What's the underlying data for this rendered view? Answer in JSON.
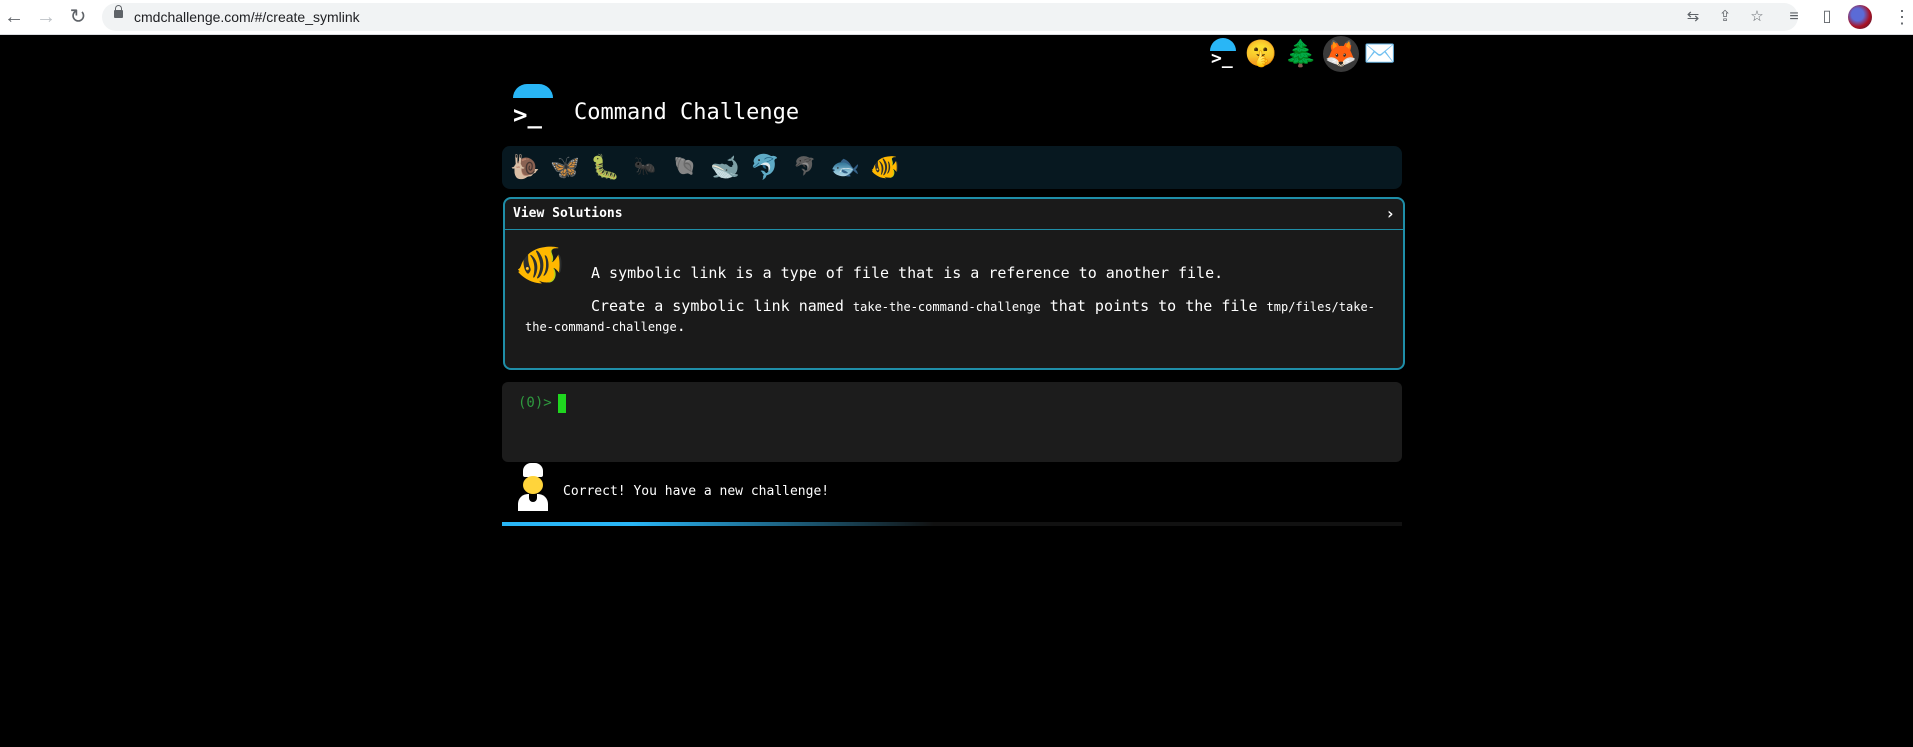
{
  "browser": {
    "url": "cmdchallenge.com/#/create_symlink",
    "back_icon": "arrow-left-icon",
    "forward_icon": "arrow-right-icon",
    "reload_icon": "reload-icon"
  },
  "top_icons": [
    "terminal-icon",
    "shushing-face-icon",
    "tree-icon",
    "gitlab-fox-icon",
    "envelope-icon"
  ],
  "header": {
    "title": "Command Challenge"
  },
  "levels": {
    "icons": [
      "snail",
      "butterfly",
      "caterpillar",
      "ant",
      "shell",
      "whale",
      "dolphin",
      "dolphin",
      "fish",
      "tropical-fish"
    ],
    "active": "tropical-fish"
  },
  "challenge": {
    "header_label": "View Solutions",
    "intro": "A symbolic link is a type of file that is a reference to another file.",
    "task_prefix": "Create a symbolic link named ",
    "link_name": "take-the-command-challenge",
    "task_middle": " that points to the file ",
    "target_path": "tmp/files/take-the-command-challenge",
    "task_suffix": "."
  },
  "terminal": {
    "prompt": "(0)>"
  },
  "status": {
    "message": "Correct! You have a new challenge!"
  },
  "progress": {
    "percent": 30
  },
  "colors": {
    "accent": "#29b6f6",
    "border": "#1f8ea8",
    "cursor": "#1fd61f"
  }
}
